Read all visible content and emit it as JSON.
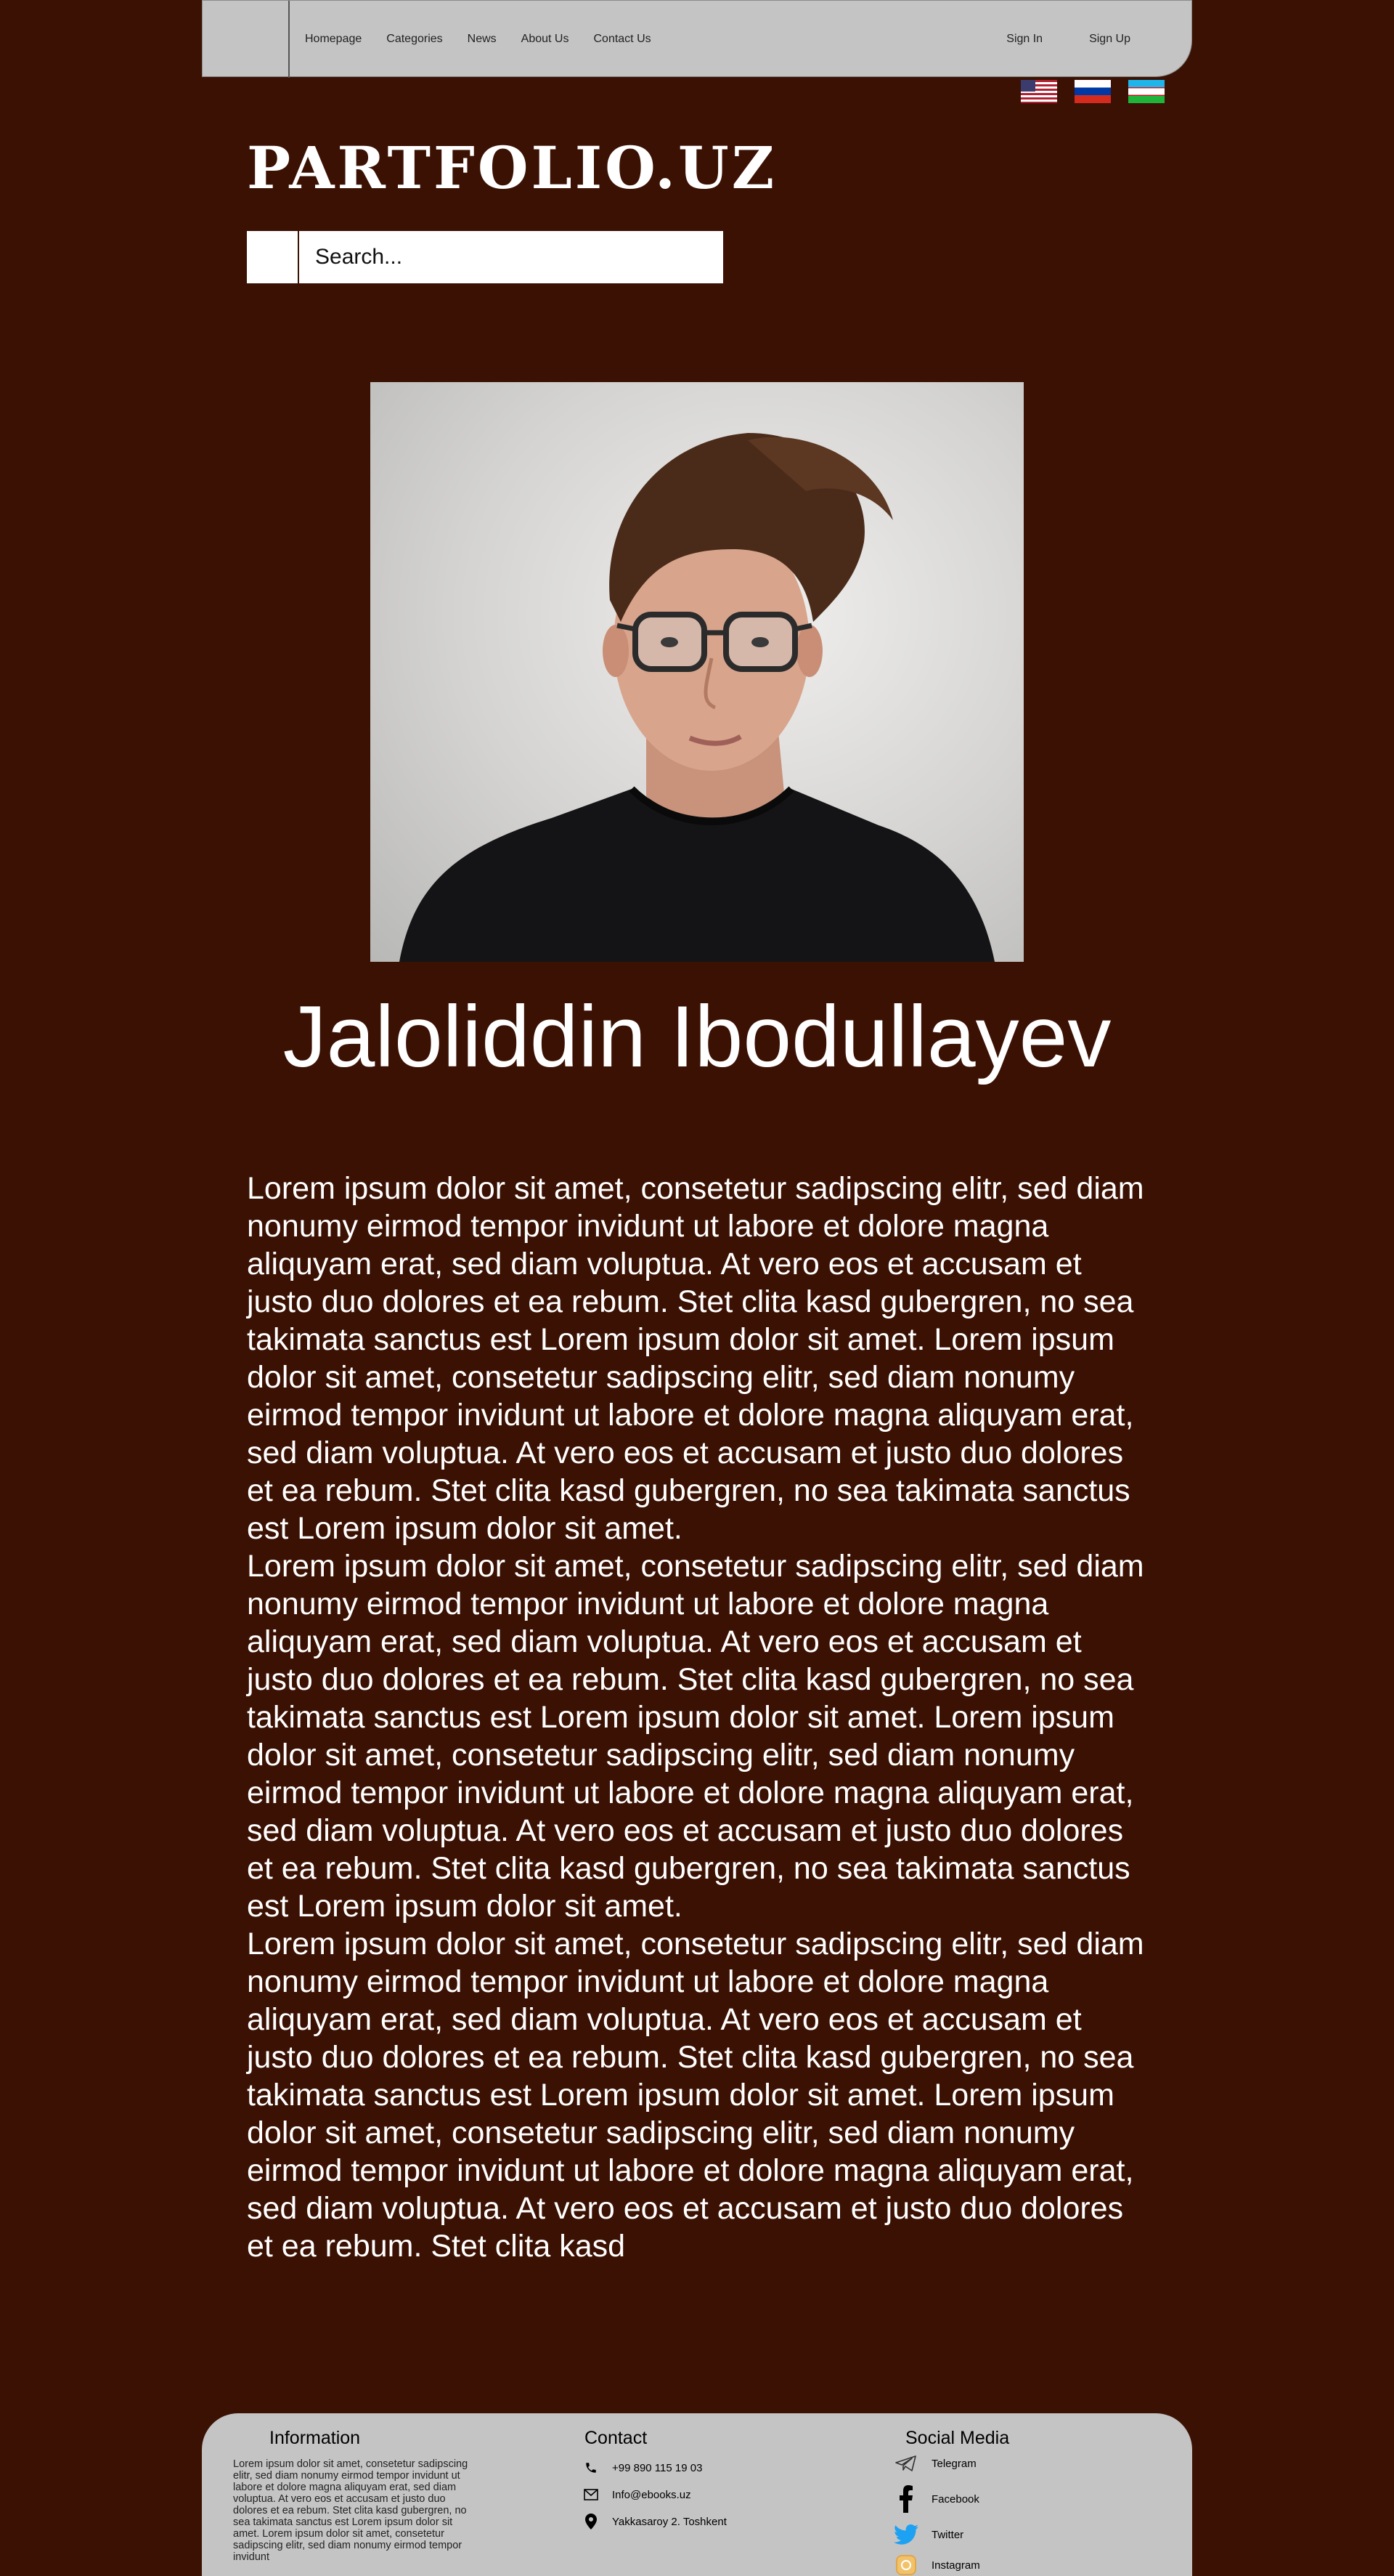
{
  "nav": {
    "links": [
      "Homepage",
      "Categories",
      "News",
      "About Us",
      "Contact Us"
    ],
    "auth": [
      "Sign In",
      "Sign Up"
    ]
  },
  "flags": [
    "flag-usa-icon",
    "flag-russia-icon",
    "flag-uzbekistan-icon"
  ],
  "brand": "PARTFOLIO.UZ",
  "search": {
    "placeholder": "Search..."
  },
  "profile": {
    "name": "Jaloliddin Ibodullayev",
    "bio": [
      "Lorem ipsum dolor sit amet, consetetur sadipscing elitr, sed diam nonumy eirmod tempor invidunt ut labore et dolore magna aliquyam erat, sed diam voluptua. At vero eos et accusam et justo duo dolores et ea rebum. Stet clita kasd gubergren, no sea takimata sanctus est Lorem ipsum dolor sit amet. Lorem ipsum dolor sit amet, consetetur sadipscing elitr, sed diam nonumy eirmod tempor invidunt ut labore et dolore magna aliquyam erat, sed diam voluptua. At vero eos et accusam et justo duo dolores et ea rebum. Stet clita kasd gubergren, no sea takimata sanctus est Lorem ipsum dolor sit amet.",
      "Lorem ipsum dolor sit amet, consetetur sadipscing elitr, sed diam nonumy eirmod tempor invidunt ut labore et dolore magna aliquyam erat, sed diam voluptua. At vero eos et accusam et justo duo dolores et ea rebum. Stet clita kasd gubergren, no sea takimata sanctus est Lorem ipsum dolor sit amet. Lorem ipsum dolor sit amet, consetetur sadipscing elitr, sed diam nonumy eirmod tempor invidunt ut labore et dolore magna aliquyam erat, sed diam voluptua. At vero eos et accusam et justo duo dolores et ea rebum. Stet clita kasd gubergren, no sea takimata sanctus est Lorem ipsum dolor sit amet.",
      "Lorem ipsum dolor sit amet, consetetur sadipscing elitr, sed diam nonumy eirmod tempor invidunt ut labore et dolore magna aliquyam erat, sed diam voluptua. At vero eos et accusam et justo duo dolores et ea rebum. Stet clita kasd gubergren, no sea takimata sanctus est Lorem ipsum dolor sit amet. Lorem ipsum dolor sit amet, consetetur sadipscing elitr, sed diam nonumy eirmod tempor invidunt ut labore et dolore magna aliquyam erat, sed diam voluptua. At vero eos et accusam et justo duo dolores et ea rebum. Stet clita kasd"
    ]
  },
  "footer": {
    "information": {
      "title": "Information",
      "text": "Lorem ipsum dolor sit amet, consetetur sadipscing elitr, sed diam nonumy eirmod tempor invidunt ut labore et dolore magna aliquyam erat, sed diam voluptua. At vero eos et accusam et justo duo dolores et ea rebum. Stet clita kasd gubergren, no sea takimata sanctus est Lorem ipsum dolor sit amet. Lorem ipsum dolor sit amet, consetetur sadipscing elitr, sed diam nonumy eirmod tempor invidunt"
    },
    "contact": {
      "title": "Contact",
      "phone": "+99 890 115 19 03",
      "email": "Info@ebooks.uz",
      "address": "Yakkasaroy 2. Toshkent"
    },
    "social": {
      "title": "Social Media",
      "items": [
        "Telegram",
        "Facebook",
        "Twitter",
        "Instagram"
      ]
    }
  },
  "colors": {
    "background": "#3b1103",
    "panel": "#c4c4c4",
    "text": "#ffffff"
  }
}
